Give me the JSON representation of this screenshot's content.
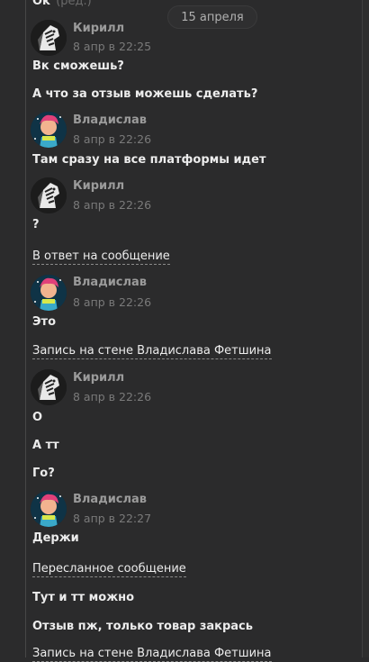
{
  "top_message": {
    "text": "Ok",
    "edited": "(ред.)"
  },
  "date_separator": "15 апреля",
  "messages": [
    {
      "author": "Кирилл",
      "time": "8 апр в 22:25",
      "lines": [
        "Вк сможешь?",
        "А что за отзыв можешь сделать?"
      ]
    },
    {
      "author": "Владислав",
      "time": "8 апр в 22:26",
      "lines": [
        "Там сразу на все платформы идет"
      ]
    },
    {
      "author": "Кирилл",
      "time": "8 апр в 22:26",
      "lines": [
        "?"
      ],
      "attachment": "В ответ на сообщение"
    },
    {
      "author": "Владислав",
      "time": "8 апр в 22:26",
      "lines": [
        "Это"
      ],
      "attachment": "Запись на стене Владислава Фетшина"
    },
    {
      "author": "Кирилл",
      "time": "8 апр в 22:26",
      "lines": [
        "О",
        "А тт",
        "Го?"
      ]
    },
    {
      "author": "Владислав",
      "time": "8 апр в 22:27",
      "lines": [
        "Держи"
      ],
      "attachment": "Пересланное сообщение",
      "after_lines": [
        "Тут и тт можно",
        "Отзыв пж, только товар закрась"
      ],
      "trailing_attachment": "Запись на стене Владислава Фетшина"
    }
  ]
}
